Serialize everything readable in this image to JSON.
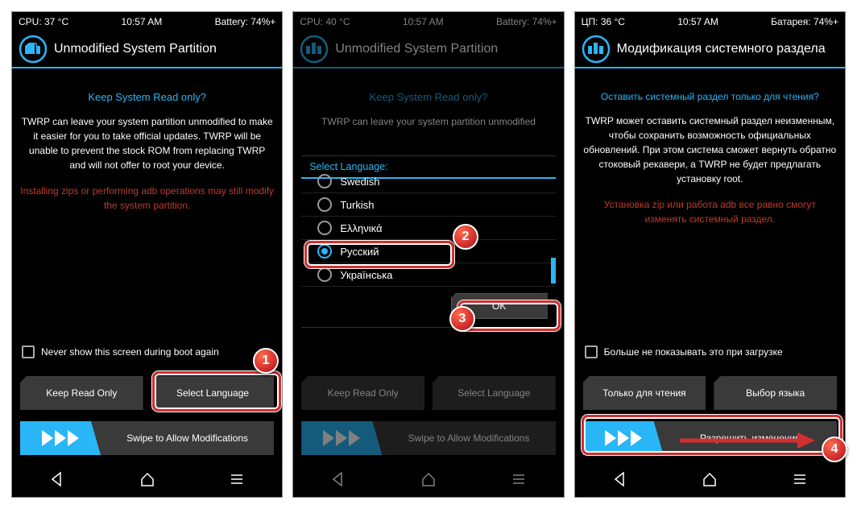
{
  "screens": [
    {
      "status": {
        "cpu": "CPU: 37 °C",
        "time": "10:57 AM",
        "battery": "Battery: 74%+"
      },
      "title": "Unmodified System Partition",
      "question": "Keep System Read only?",
      "desc": "TWRP can leave your system partition unmodified to make it easier for you to take official updates. TWRP will be unable to prevent the stock ROM from replacing TWRP and will not offer to root your device.",
      "warning": "Installing zips or performing adb operations may still modify the system partition.",
      "checkbox": "Never show this screen during boot again",
      "btn_left": "Keep Read Only",
      "btn_right": "Select Language",
      "swipe": "Swipe to Allow Modifications"
    },
    {
      "status": {
        "cpu": "CPU: 40 °C",
        "time": "10:57 AM",
        "battery": "Battery: 74%+"
      },
      "title": "Unmodified System Partition",
      "question": "Keep System Read only?",
      "desc": "TWRP can leave your system partition unmodified",
      "dialog_title": "Select Language:",
      "languages": [
        "Swedish",
        "Turkish",
        "Ελληνικά",
        "Русский",
        "Українська"
      ],
      "selected_index": 3,
      "ok": "OK",
      "btn_left": "Keep Read Only",
      "btn_right": "Select Language",
      "swipe": "Swipe to Allow Modifications"
    },
    {
      "status": {
        "cpu": "ЦП: 36 °C",
        "time": "10:57 AM",
        "battery": "Батарея: 74%+"
      },
      "title": "Модификация системного раздела",
      "question": "Оставить системный раздел только для чтения?",
      "desc": "TWRP может оставить системный раздел неизменным, чтобы сохранить возможность официальных обновлений. При этом система сможет вернуть обратно стоковый рекавери, а TWRP не будет предлагать установку root.",
      "warning": "Установка zip или работа adb все равно смогут изменять системный раздел.",
      "checkbox": "Больше не показывать это при загрузке",
      "btn_left": "Только для чтения",
      "btn_right": "Выбор языка",
      "swipe": "Разрешить изменения"
    }
  ],
  "callouts": {
    "1": "1",
    "2": "2",
    "3": "3",
    "4": "4"
  }
}
